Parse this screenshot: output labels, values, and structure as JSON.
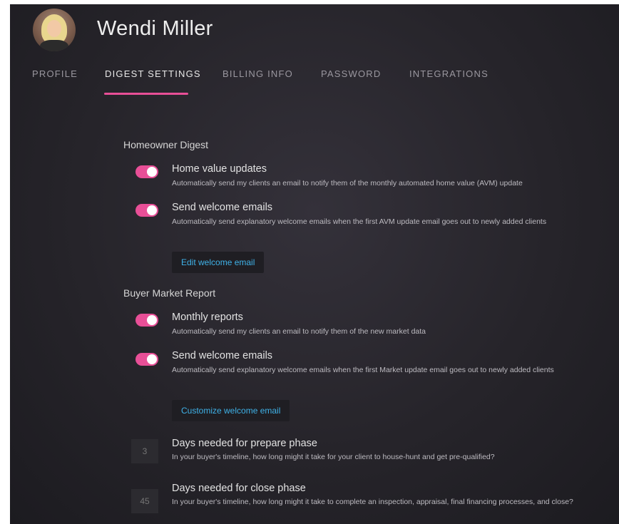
{
  "user": {
    "name": "Wendi Miller"
  },
  "tabs": [
    {
      "label": "PROFILE"
    },
    {
      "label": "DIGEST SETTINGS"
    },
    {
      "label": "BILLING INFO"
    },
    {
      "label": "PASSWORD"
    },
    {
      "label": "INTEGRATIONS"
    }
  ],
  "active_tab": "DIGEST SETTINGS",
  "colors": {
    "accent": "#e84f97",
    "link": "#3fb2e8",
    "background": "#2a282e"
  },
  "homeowner": {
    "title": "Homeowner Digest",
    "options": [
      {
        "title": "Home value updates",
        "desc": "Automatically send my clients an email to notify them of the monthly automated home value (AVM) update",
        "enabled": true
      },
      {
        "title": "Send welcome emails",
        "desc": "Automatically send explanatory welcome emails when the first AVM update email goes out to newly added clients",
        "enabled": true
      }
    ],
    "button": "Edit welcome email"
  },
  "buyer": {
    "title": "Buyer Market Report",
    "options": [
      {
        "title": "Monthly reports",
        "desc": "Automatically send my clients an email to notify them of the new market data",
        "enabled": true
      },
      {
        "title": "Send welcome emails",
        "desc": "Automatically send explanatory welcome emails when the first Market update email goes out to newly added clients",
        "enabled": true
      }
    ],
    "button": "Customize welcome email",
    "phases": [
      {
        "value": "3",
        "title": "Days needed for prepare phase",
        "desc": "In your buyer's timeline, how long might it take for your client to house-hunt and get pre-qualified?"
      },
      {
        "value": "45",
        "title": "Days needed for close phase",
        "desc": "In your buyer's timeline, how long might it take to complete an inspection, appraisal, final financing processes, and close?"
      }
    ]
  }
}
